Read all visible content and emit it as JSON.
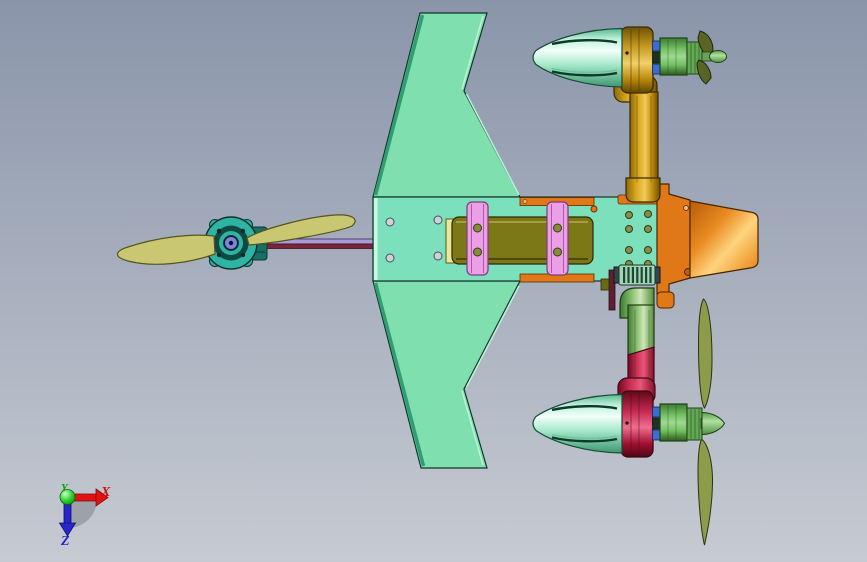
{
  "scene": {
    "subject": "CAD assembly viewport: tilt-rotor VTOL flying-wing aircraft, top view, nose left",
    "parts": [
      {
        "label": "front propeller",
        "color_key": "prop_olive"
      },
      {
        "label": "front motor",
        "color_key": "front_motor_teal"
      },
      {
        "label": "propeller shaft rod",
        "color_key": "rod_lavender"
      },
      {
        "label": "main wing",
        "color_key": "wing"
      },
      {
        "label": "center fuselage plate",
        "color_key": "center_plate"
      },
      {
        "label": "battery pack",
        "color_key": "battery_box"
      },
      {
        "label": "battery straps",
        "color_key": "strap"
      },
      {
        "label": "fuselage bulkhead",
        "color_key": "fuselage_orange"
      },
      {
        "label": "tail cone",
        "color_key": "fuselage_orange"
      },
      {
        "label": "top nacelle boom",
        "color_key": "boom_gold"
      },
      {
        "label": "bottom nacelle boom",
        "color_key": "boom_green"
      },
      {
        "label": "bottom nacelle mount",
        "color_key": "boom_crimson"
      },
      {
        "label": "nacelle spinner cones",
        "color_key": "spinner_teal"
      },
      {
        "label": "nacelle motors",
        "color_key": "motor_green"
      },
      {
        "label": "rear propeller blades",
        "color_key": "blade_olive"
      },
      {
        "label": "hinge coupler",
        "color_key": "hinge_green"
      }
    ]
  },
  "colors": {
    "background_top": "#8a95aa",
    "background_bottom": "#c6cbd2",
    "wing": "#7fdfae",
    "center_plate": "#7ce0bd",
    "battery_box": "#7c7815",
    "battery_cap": "#e8e89a",
    "strap": "#ec9fe7",
    "fuselage_orange": "#e07818",
    "boom_gold": "#cc9a12",
    "boom_green": "#7fb465",
    "boom_crimson": "#c32049",
    "motor_green": "#74c266",
    "spinner_teal": "#9fe8cc",
    "prop_olive": "#c9c772",
    "blade_olive": "#8c9c4a",
    "rod_lavender": "#a99ad8",
    "rod_maroon": "#7a2438",
    "front_motor_teal": "#2fb3a3",
    "band_blue": "#3a6cd8",
    "hinge_green": "#9fd8b0"
  },
  "triad": {
    "x_label": "X",
    "y_label": "Y",
    "z_label": "Z",
    "x_color": "#cc1111",
    "y_color": "#00a400",
    "z_color": "#2424cc"
  }
}
